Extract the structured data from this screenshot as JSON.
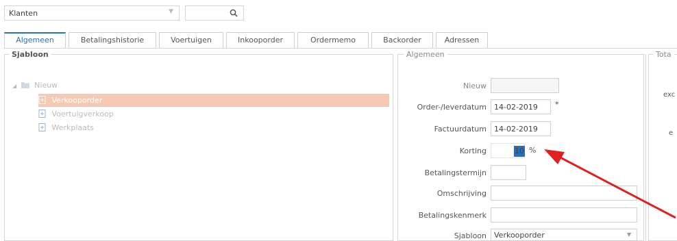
{
  "top": {
    "select_value": "Klanten",
    "select_arrow": "▼",
    "search_icon": "search-icon"
  },
  "tabs": [
    {
      "label": "Algemeen",
      "active": true
    },
    {
      "label": "Betalingshistorie",
      "active": false
    },
    {
      "label": "Voertuigen",
      "active": false
    },
    {
      "label": "Inkooporder",
      "active": false
    },
    {
      "label": "Ordermemo",
      "active": false
    },
    {
      "label": "Backorder",
      "active": false
    },
    {
      "label": "Adressen",
      "active": false
    }
  ],
  "sjabloon": {
    "title": "Sjabloon",
    "tree": {
      "root": "Nieuw",
      "items": [
        "Verkooporder",
        "Voertuigverkoop",
        "Werkplaats"
      ],
      "selected_index": 0
    }
  },
  "algemeen": {
    "title": "Algemeen",
    "fields": {
      "nieuw": {
        "label": "Nieuw",
        "value": ""
      },
      "orderdatum": {
        "label": "Order-/leverdatum",
        "value": "14-02-2019",
        "required": "*"
      },
      "factuurdatum": {
        "label": "Factuurdatum",
        "value": "14-02-2019"
      },
      "korting": {
        "label": "Korting",
        "value": "10",
        "unit": "%"
      },
      "betalingstermijn": {
        "label": "Betalingstermijn",
        "value": ""
      },
      "omschrijving": {
        "label": "Omschrijving",
        "value": ""
      },
      "betalingskenmerk": {
        "label": "Betalingskenmerk",
        "value": ""
      },
      "sjabloon": {
        "label": "Sjabloon",
        "value": "Verkooporder",
        "arrow": "▼"
      }
    }
  },
  "totaal": {
    "title": "Tota",
    "line1": "exc",
    "line2": "e"
  },
  "colors": {
    "accent": "#2a6fb6",
    "selection": "#f5c9b3",
    "arrow": "#e02020"
  }
}
